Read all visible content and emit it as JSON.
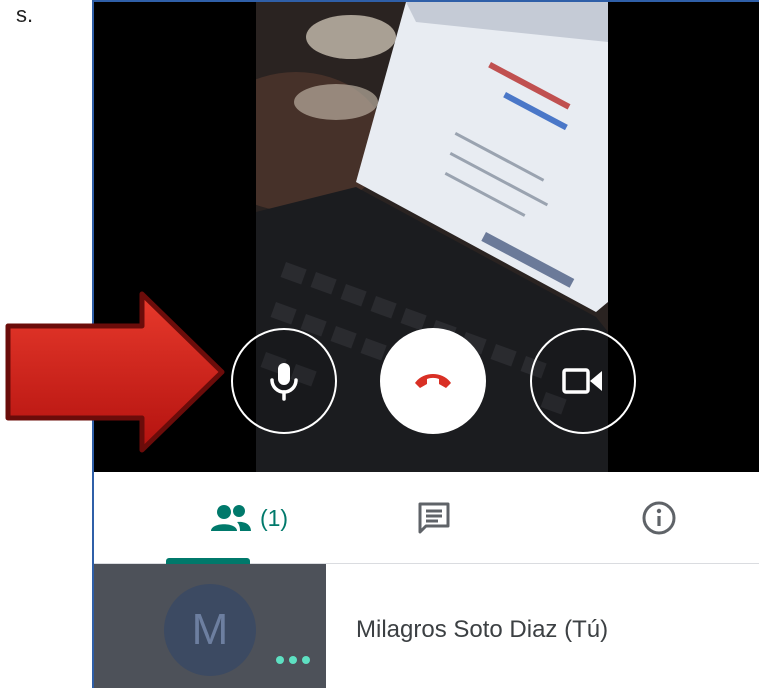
{
  "doc_fragment": "s.",
  "call": {
    "controls": {
      "mic": "microphone-icon",
      "end_call": "hangup-icon",
      "camera": "video-camera-icon"
    }
  },
  "tabs": {
    "people_count": "(1)",
    "icons": [
      "people-icon",
      "chat-icon",
      "info-icon"
    ]
  },
  "participant": {
    "initial": "M",
    "name": "Milagros Soto Diaz (Tú)"
  },
  "annotation": {
    "icon": "red-arrow-icon"
  },
  "colors": {
    "accent": "#00796b",
    "end_call": "#d93025",
    "arrow": "#d51b1b",
    "avatar_tile": "#4d5159",
    "active_dots": "#5ee0c2"
  }
}
